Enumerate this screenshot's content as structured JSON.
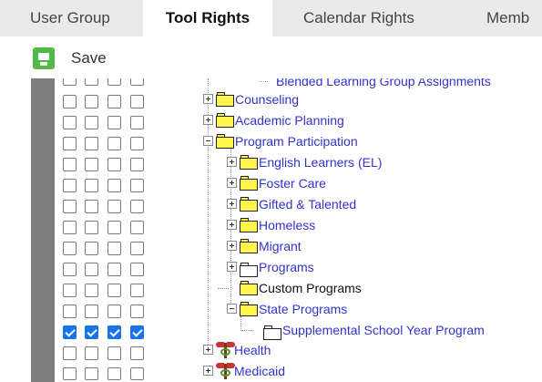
{
  "tabs": [
    {
      "label": "User Group",
      "active": false
    },
    {
      "label": "Tool Rights",
      "active": true
    },
    {
      "label": "Calendar Rights",
      "active": false
    },
    {
      "label": "Memb",
      "active": false
    }
  ],
  "toolbar": {
    "save_label": "Save"
  },
  "tree": {
    "partial_top_item": "Blended Learning Group Assignments",
    "items": [
      {
        "label": "Counseling",
        "icon": "folder-icon",
        "expander": "plus"
      },
      {
        "label": "Academic Planning",
        "icon": "folder-icon",
        "expander": "plus"
      },
      {
        "label": "Program Participation",
        "icon": "folder-icon",
        "expander": "minus"
      },
      {
        "label": "English Learners (EL)",
        "icon": "folder-icon",
        "expander": "plus"
      },
      {
        "label": "Foster Care",
        "icon": "folder-icon",
        "expander": "plus"
      },
      {
        "label": "Gifted & Talented",
        "icon": "folder-icon",
        "expander": "plus"
      },
      {
        "label": "Homeless",
        "icon": "folder-icon",
        "expander": "plus"
      },
      {
        "label": "Migrant",
        "icon": "folder-icon",
        "expander": "plus"
      },
      {
        "label": "Programs",
        "icon": "open-folder-icon",
        "expander": "plus"
      },
      {
        "label": "Custom Programs",
        "icon": "folder-icon",
        "expander": "none"
      },
      {
        "label": "State Programs",
        "icon": "folder-icon",
        "expander": "minus"
      },
      {
        "label": "Supplemental School Year Program",
        "icon": "open-folder-icon",
        "expander": "none"
      },
      {
        "label": "Health",
        "icon": "caduceus-icon",
        "expander": "plus"
      },
      {
        "label": "Medicaid",
        "icon": "caduceus-icon",
        "expander": "plus"
      }
    ]
  },
  "checkbox_rows": [
    [
      false,
      false,
      false,
      false
    ],
    [
      false,
      false,
      false,
      false
    ],
    [
      false,
      false,
      false,
      false
    ],
    [
      false,
      false,
      false,
      false
    ],
    [
      false,
      false,
      false,
      false
    ],
    [
      false,
      false,
      false,
      false
    ],
    [
      false,
      false,
      false,
      false
    ],
    [
      false,
      false,
      false,
      false
    ],
    [
      false,
      false,
      false,
      false
    ],
    [
      false,
      false,
      false,
      false
    ],
    [
      false,
      false,
      false,
      false
    ],
    [
      false,
      false,
      false,
      false
    ],
    [
      true,
      true,
      true,
      true
    ],
    [
      false,
      false,
      false,
      false
    ],
    [
      false,
      false,
      false,
      false
    ]
  ],
  "colors": {
    "link": "#3333cc",
    "checked": "#1a73e8",
    "save": "#52b94b",
    "tabbar": "#eaeaea"
  }
}
